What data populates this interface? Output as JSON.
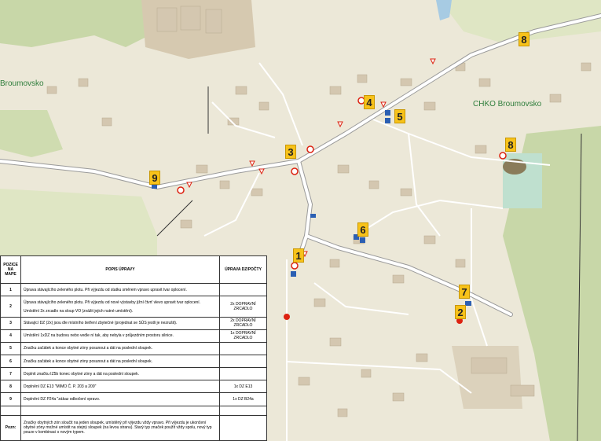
{
  "map_labels": {
    "left_place": "Broumovsko",
    "right_place": "CHKO Broumovsko"
  },
  "markers": [
    "1",
    "2",
    "3",
    "4",
    "5",
    "6",
    "7",
    "8",
    "8",
    "9"
  ],
  "table": {
    "headers": {
      "position": "POZICE NA MAPE",
      "description": "POPIS ÚPRAVY",
      "change": "ÚPRAVA DZ/POČTY"
    },
    "rows": [
      {
        "pos": "1",
        "desc": "Úprava stávajícího zeleného plotu. Při výjezdu od statku směrem vpravo upravit tvar oplocení.",
        "change": ""
      },
      {
        "pos": "2",
        "desc": "Úprava stávajícího zeleného plotu. Při výjezdu od nové výstavby jižní čtvrť vlevo upravit tvar oplocení.",
        "desc2": "Umístění 2x zrcadlo na sloup VO (zvážit jejich nutné umístění).",
        "change": "2x DOPRAVNÍ ZRCADLO"
      },
      {
        "pos": "3",
        "desc": "Stávající DZ (2x) jsou dle místního šetření zbytečné (projednat se SÚS jestli je nezrušit).",
        "change": "2x DOPRAVNÍ ZRCADLO"
      },
      {
        "pos": "4",
        "desc": "Umístění 1xDZ na budovu nebo vedle ní tak, aby nebyla v průjezdním prostoru silnice.",
        "change": "1x DOPRAVNÍ ZRCADLO"
      },
      {
        "pos": "5",
        "desc": "Značku začátek a konce obytné zóny posunout a dát na poslední sloupek.",
        "change": ""
      },
      {
        "pos": "6",
        "desc": "Značku začátek a konce obytné zóny posunout a dát na poslední sloupek.",
        "change": ""
      },
      {
        "pos": "7",
        "desc": "Doplnit značku IZ5b konec obytné zóny a dát na poslední sloupek.",
        "change": ""
      },
      {
        "pos": "8",
        "desc": "Doplnění DZ E13 \"MIMO Č. P. 203 a 209\"",
        "change": "1x DZ E13"
      },
      {
        "pos": "9",
        "desc": "Doplnění DZ P24a \"zákaz odbočení vpravo.",
        "change": "1x DZ B24a"
      },
      {
        "pos": "",
        "desc": "",
        "change": ""
      }
    ],
    "note_label": "Pozn:",
    "note_text": "Značky obytných zón sloučit na jeden sloupek, umístěný při výjezdu vždy vpravo. Při výjezdu je ukončení obytné zóny možné umístit na stejný sloupek (na levou stranu). Starý typ značek použít vždy spolu, nový typ pouze v kombinaci s novým typem."
  }
}
